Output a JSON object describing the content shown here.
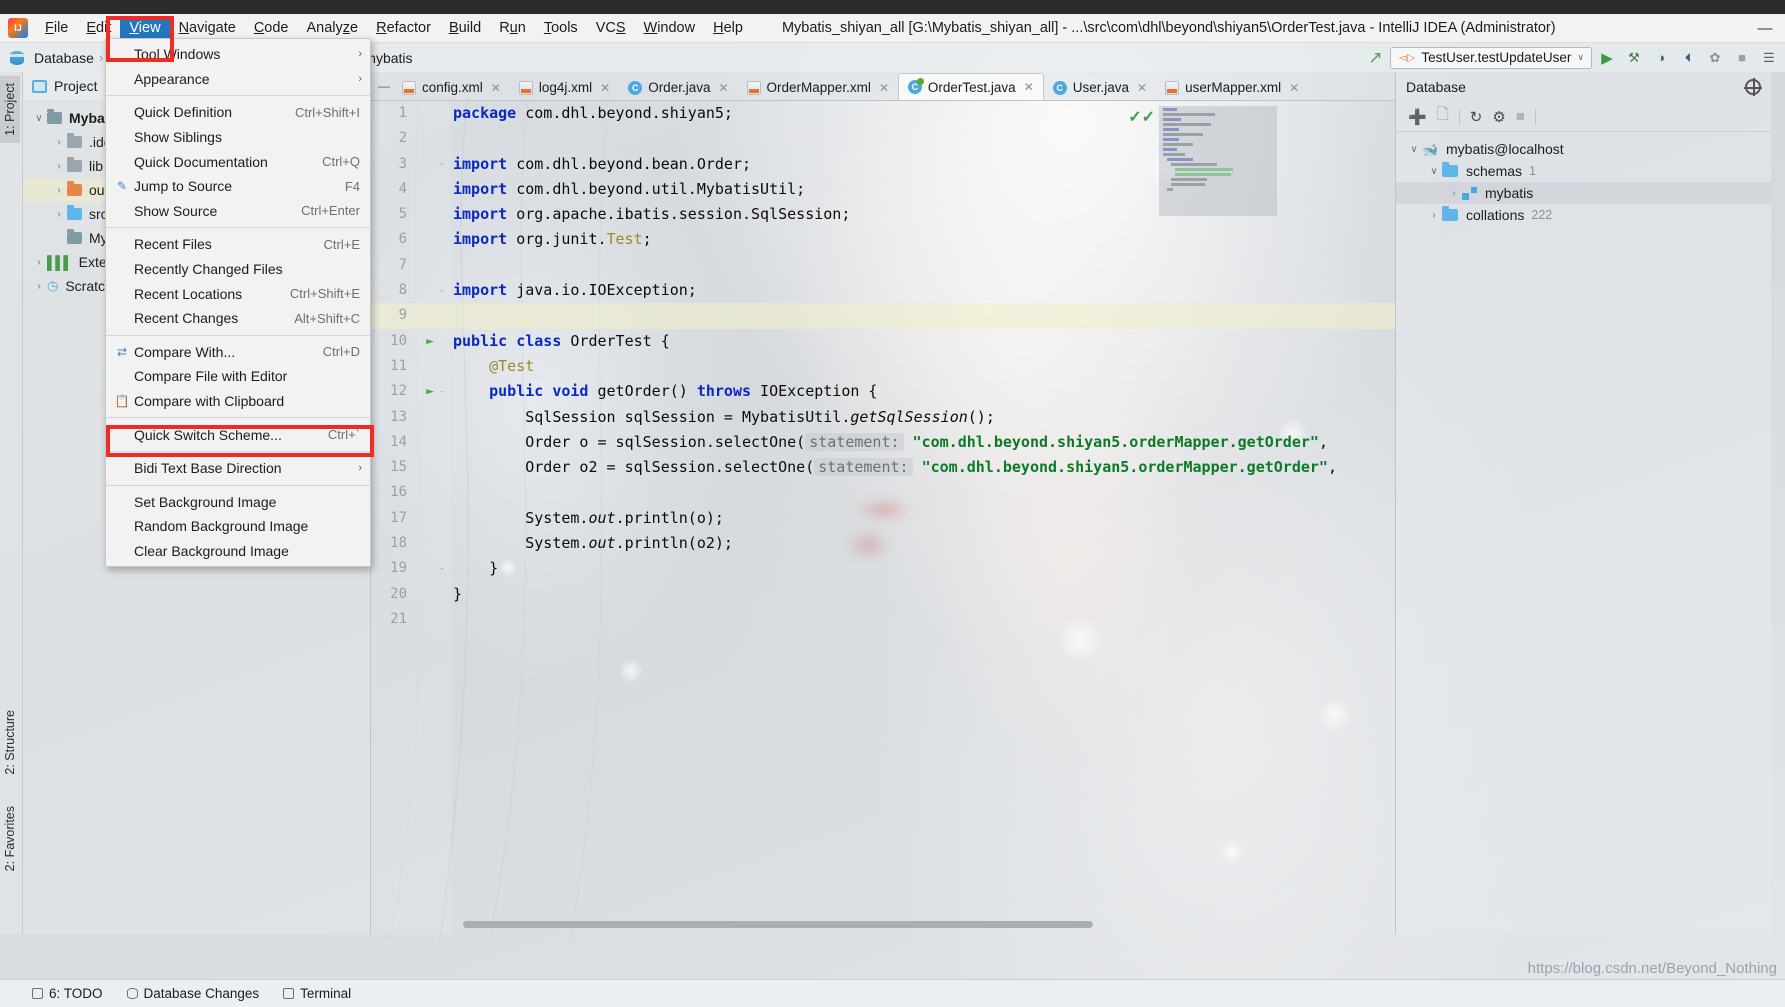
{
  "window": {
    "title": "Mybatis_shiyan_all [G:\\Mybatis_shiyan_all] - ...\\src\\com\\dhl\\beyond\\shiyan5\\OrderTest.java - IntelliJ IDEA (Administrator)",
    "minimize": "—",
    "maximize": "□",
    "close": "✕"
  },
  "menubar": {
    "items": [
      {
        "label": "File",
        "mnemonic": "F"
      },
      {
        "label": "Edit",
        "mnemonic": "E"
      },
      {
        "label": "View",
        "mnemonic": "V",
        "active": true
      },
      {
        "label": "Navigate",
        "mnemonic": "N"
      },
      {
        "label": "Code",
        "mnemonic": "C"
      },
      {
        "label": "Analyze",
        "mnemonic": "z"
      },
      {
        "label": "Refactor",
        "mnemonic": "R"
      },
      {
        "label": "Build",
        "mnemonic": "B"
      },
      {
        "label": "Run",
        "mnemonic": "u"
      },
      {
        "label": "Tools",
        "mnemonic": "T"
      },
      {
        "label": "VCS",
        "mnemonic": "S"
      },
      {
        "label": "Window",
        "mnemonic": "W"
      },
      {
        "label": "Help",
        "mnemonic": "H"
      }
    ]
  },
  "view_menu": {
    "items": [
      {
        "label": "Tool Windows",
        "shortcut": "",
        "submenu": true,
        "icon": ""
      },
      {
        "label": "Appearance",
        "shortcut": "",
        "submenu": true,
        "icon": ""
      },
      {
        "sep": true
      },
      {
        "label": "Quick Definition",
        "shortcut": "Ctrl+Shift+I",
        "icon": ""
      },
      {
        "label": "Show Siblings",
        "shortcut": "",
        "icon": ""
      },
      {
        "label": "Quick Documentation",
        "shortcut": "Ctrl+Q",
        "icon": ""
      },
      {
        "label": "Jump to Source",
        "shortcut": "F4",
        "icon": "pencil-icon"
      },
      {
        "label": "Show Source",
        "shortcut": "Ctrl+Enter",
        "icon": ""
      },
      {
        "sep": true
      },
      {
        "label": "Recent Files",
        "shortcut": "Ctrl+E",
        "icon": ""
      },
      {
        "label": "Recently Changed Files",
        "shortcut": "",
        "icon": ""
      },
      {
        "label": "Recent Locations",
        "shortcut": "Ctrl+Shift+E",
        "icon": ""
      },
      {
        "label": "Recent Changes",
        "shortcut": "Alt+Shift+C",
        "icon": ""
      },
      {
        "sep": true
      },
      {
        "label": "Compare With...",
        "shortcut": "Ctrl+D",
        "icon": "compare-icon"
      },
      {
        "label": "Compare File with Editor",
        "shortcut": "",
        "icon": ""
      },
      {
        "label": "Compare with Clipboard",
        "shortcut": "",
        "icon": "clipboard-compare-icon"
      },
      {
        "sep": true
      },
      {
        "label": "Quick Switch Scheme...",
        "shortcut": "Ctrl+`",
        "icon": ""
      },
      {
        "sep": true
      },
      {
        "label": "Bidi Text Base Direction",
        "shortcut": "",
        "submenu": true,
        "icon": ""
      },
      {
        "sep": true
      },
      {
        "label": "Set Background Image",
        "shortcut": "",
        "icon": "",
        "highlighted": true
      },
      {
        "label": "Random Background Image",
        "shortcut": "",
        "icon": ""
      },
      {
        "label": "Clear Background Image",
        "shortcut": "",
        "icon": ""
      }
    ]
  },
  "navbar": {
    "crumbs": [
      "Database",
      "mybatis"
    ],
    "separator": "›"
  },
  "run_toolbar": {
    "config_name": "TestUser.testUpdateUser",
    "caret": "∨",
    "run_icon": "▶",
    "debug_icon": "🐞",
    "coverage_icon": "◑",
    "profile_icon": "◴",
    "attach_icon": "✿",
    "stop_icon": "■",
    "layout_icon": "☰",
    "hammer_icon": "⚒"
  },
  "left_strip": {
    "top": "1: Project",
    "middle": "2: Structure",
    "bottom": "2: Favorites"
  },
  "project_panel": {
    "title": "Project",
    "tree": [
      {
        "depth": 0,
        "arrow": "∨",
        "label": "Mybatis_shiyan_all",
        "color": "f-teal",
        "bold": true
      },
      {
        "depth": 1,
        "arrow": "›",
        "label": ".idea",
        "color": "f-gray",
        "bold": false
      },
      {
        "depth": 1,
        "arrow": "›",
        "label": "lib",
        "color": "f-gray",
        "bold": false
      },
      {
        "depth": 1,
        "arrow": "›",
        "label": "out",
        "color": "f-orange",
        "bold": false,
        "highlighted": true
      },
      {
        "depth": 1,
        "arrow": "›",
        "label": "src",
        "color": "f-blue",
        "bold": false
      },
      {
        "depth": 1,
        "arrow": "",
        "label": "Mybatis_shiyan_all.iml",
        "color": "f-teal",
        "bold": false
      },
      {
        "depth": 0,
        "arrow": "›",
        "label": "External Libraries",
        "color": "lib",
        "bold": false
      },
      {
        "depth": 0,
        "arrow": "›",
        "label": "Scratches and Consoles",
        "color": "scratch",
        "bold": false
      }
    ]
  },
  "editor": {
    "tabs": [
      {
        "label": "config.xml",
        "type": "xml",
        "selected": false
      },
      {
        "label": "log4j.xml",
        "type": "xml",
        "selected": false
      },
      {
        "label": "Order.java",
        "type": "java",
        "selected": false
      },
      {
        "label": "OrderMapper.xml",
        "type": "xml",
        "selected": false
      },
      {
        "label": "OrderTest.java",
        "type": "javatest",
        "selected": true
      },
      {
        "label": "User.java",
        "type": "java",
        "selected": false
      },
      {
        "label": "userMapper.xml",
        "type": "xml",
        "selected": false
      }
    ],
    "close_glyph": "✕",
    "lines": [
      {
        "n": 1,
        "gutter": "",
        "fold": "",
        "html": "<span class=\"kw\">package</span> com.dhl.beyond.shiyan5;",
        "indent": 0
      },
      {
        "n": 2,
        "gutter": "",
        "fold": "",
        "html": "",
        "indent": 0
      },
      {
        "n": 3,
        "gutter": "",
        "fold": "-",
        "html": "<span class=\"kw\">import</span> com.dhl.beyond.bean.Order;",
        "indent": 0
      },
      {
        "n": 4,
        "gutter": "",
        "fold": "",
        "html": "<span class=\"kw\">import</span> com.dhl.beyond.util.MybatisUtil;",
        "indent": 0
      },
      {
        "n": 5,
        "gutter": "",
        "fold": "",
        "html": "<span class=\"kw\">import</span> org.apache.ibatis.session.SqlSession;",
        "indent": 0
      },
      {
        "n": 6,
        "gutter": "",
        "fold": "",
        "html": "<span class=\"kw\">import</span> org.junit.<span class=\"ann\">Test</span>;",
        "indent": 0
      },
      {
        "n": 7,
        "gutter": "",
        "fold": "",
        "html": "",
        "indent": 0
      },
      {
        "n": 8,
        "gutter": "",
        "fold": "-",
        "html": "<span class=\"kw\">import</span> java.io.IOException;",
        "indent": 0
      },
      {
        "n": 9,
        "gutter": "",
        "fold": "",
        "html": "",
        "indent": 0,
        "highlight": true
      },
      {
        "n": 10,
        "gutter": "run",
        "fold": "",
        "html": "<span class=\"kw\">public class</span> OrderTest {",
        "indent": 0
      },
      {
        "n": 11,
        "gutter": "",
        "fold": "",
        "html": "    <span class=\"ann\">@Test</span>",
        "indent": 0
      },
      {
        "n": 12,
        "gutter": "run",
        "fold": "-",
        "html": "    <span class=\"kw\">public</span> <span class=\"kw\">void</span> getOrder() <span class=\"kw\">throws</span> IOException {",
        "indent": 0
      },
      {
        "n": 13,
        "gutter": "",
        "fold": "",
        "html": "        SqlSession sqlSession = MybatisUtil.<span class=\"ital\">getSqlSession</span>();",
        "indent": 0
      },
      {
        "n": 14,
        "gutter": "",
        "fold": "",
        "html": "        Order o = sqlSession.selectOne(<span class=\"hintbg\">statement:</span> <span class=\"str\">\"com.dhl.beyond.shiyan5.orderMapper.getOrder\"</span>,",
        "indent": 0
      },
      {
        "n": 15,
        "gutter": "",
        "fold": "",
        "html": "        Order o2 = sqlSession.selectOne(<span class=\"hintbg\">statement:</span> <span class=\"str\">\"com.dhl.beyond.shiyan5.orderMapper.getOrder\"</span>,",
        "indent": 0
      },
      {
        "n": 16,
        "gutter": "",
        "fold": "",
        "html": "",
        "indent": 0
      },
      {
        "n": 17,
        "gutter": "",
        "fold": "",
        "html": "        System.<span class=\"ital\">out</span>.println(o);",
        "indent": 0
      },
      {
        "n": 18,
        "gutter": "",
        "fold": "",
        "html": "        System.<span class=\"ital\">out</span>.println(o2);",
        "indent": 0
      },
      {
        "n": 19,
        "gutter": "",
        "fold": "-",
        "html": "    }",
        "indent": 0
      },
      {
        "n": 20,
        "gutter": "",
        "fold": "",
        "html": "}",
        "indent": 0
      },
      {
        "n": 21,
        "gutter": "",
        "fold": "",
        "html": "",
        "indent": 0
      }
    ]
  },
  "database_panel": {
    "title": "Database",
    "settings_icon": "target-icon",
    "toolbar_icons": [
      "add-icon",
      "copy-icon",
      "refresh-icon",
      "sql-script-icon",
      "stop-icon"
    ],
    "tree": [
      {
        "depth": 0,
        "arrow": "∨",
        "label": "mybatis@localhost",
        "icon": "dolphin-icon",
        "count": ""
      },
      {
        "depth": 1,
        "arrow": "∨",
        "label": "schemas",
        "icon": "folder-icon",
        "count": "1"
      },
      {
        "depth": 2,
        "arrow": "›",
        "label": "mybatis",
        "icon": "schema-icon",
        "count": "",
        "selected": true
      },
      {
        "depth": 1,
        "arrow": "›",
        "label": "collations",
        "icon": "folder-icon",
        "count": "222"
      }
    ]
  },
  "statusbar": {
    "items": [
      {
        "label": "6: TODO",
        "icon": "list-icon"
      },
      {
        "label": "Database Changes",
        "icon": "db-changes-icon"
      },
      {
        "label": "Terminal",
        "icon": "terminal-icon"
      }
    ]
  },
  "watermark": "https://blog.csdn.net/Beyond_Nothing"
}
